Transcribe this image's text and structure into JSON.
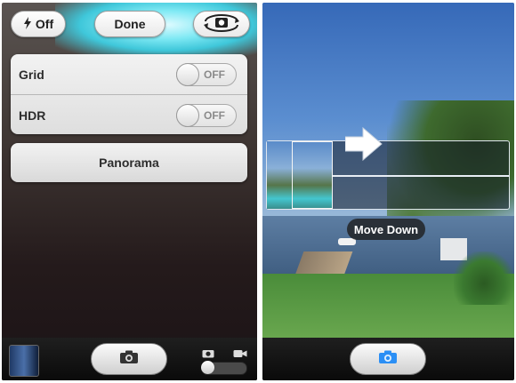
{
  "left_screen": {
    "flash": {
      "icon": "lightning-icon",
      "label": "Off"
    },
    "done_label": "Done",
    "flip_icon": "camera-flip-icon",
    "settings": [
      {
        "label": "Grid",
        "state": "OFF"
      },
      {
        "label": "HDR",
        "state": "OFF"
      }
    ],
    "panorama_label": "Panorama",
    "bottom": {
      "shutter_icon": "camera-icon",
      "mode_icons": [
        "camera-icon",
        "video-icon"
      ]
    }
  },
  "right_screen": {
    "guide_label": "Move Down",
    "shutter_icon": "camera-icon",
    "shutter_color": "#2b8ff5"
  }
}
